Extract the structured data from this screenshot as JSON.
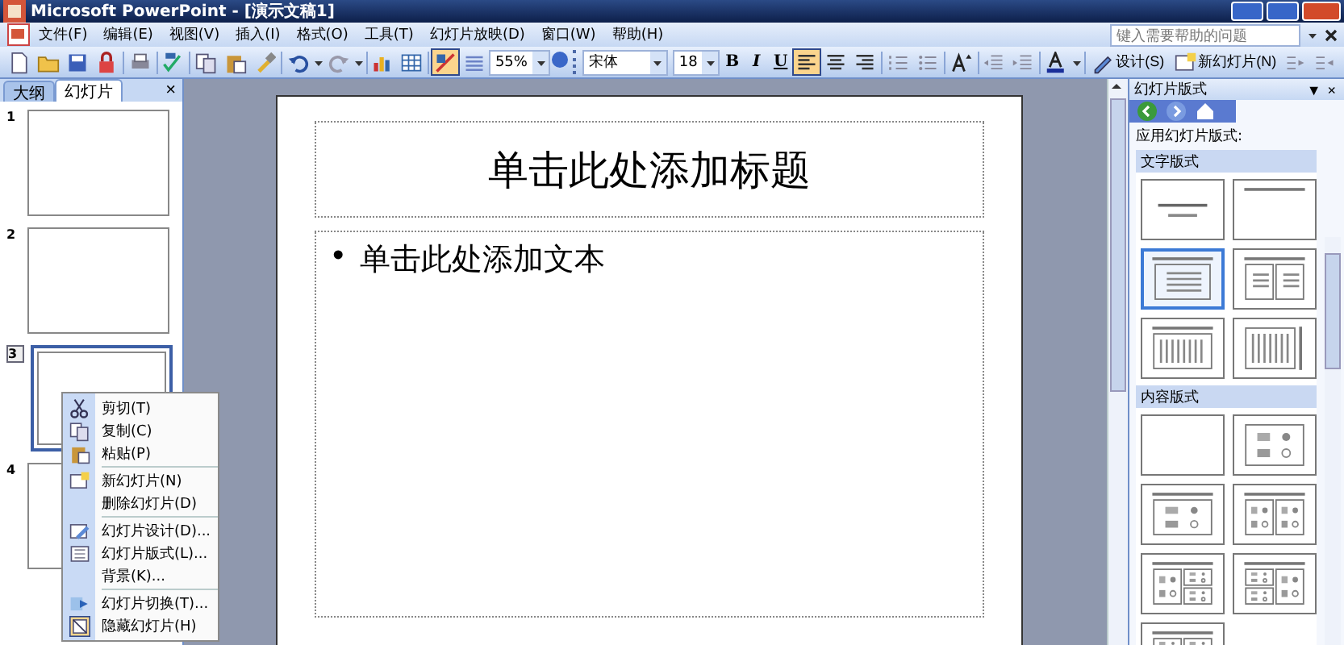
{
  "window": {
    "title": "Microsoft PowerPoint - [演示文稿1]"
  },
  "menu": [
    "文件(F)",
    "编辑(E)",
    "视图(V)",
    "插入(I)",
    "格式(O)",
    "工具(T)",
    "幻灯片放映(D)",
    "窗口(W)",
    "帮助(H)"
  ],
  "help_box": {
    "placeholder": "键入需要帮助的问题"
  },
  "toolbar": {
    "zoom": "55%",
    "font": "宋体",
    "font_size": "18",
    "bold": "B",
    "italic": "I",
    "underline": "U",
    "show_formatting": {
      "selected": true
    },
    "alignment": [
      {
        "selected": true
      },
      {
        "selected": false
      },
      {
        "selected": false
      }
    ],
    "design_button": "设计(S)",
    "new_slide_button": "新幻灯片(N)"
  },
  "left_pane": {
    "tabs": [
      {
        "label": "大纲",
        "selected": false
      },
      {
        "label": "幻灯片",
        "selected": true
      }
    ],
    "close": "×",
    "slides": [
      {
        "number": "1",
        "selected": false
      },
      {
        "number": "2",
        "selected": false
      },
      {
        "number": "3",
        "selected": true
      },
      {
        "number": "4",
        "selected": false
      }
    ]
  },
  "slide": {
    "title_placeholder": "单击此处添加标题",
    "bullet": "•",
    "body_placeholder": "单击此处添加文本"
  },
  "context_menu": [
    [
      {
        "label": "剪切(T)"
      },
      {
        "label": "复制(C)"
      },
      {
        "label": "粘贴(P)"
      }
    ],
    [
      {
        "label": "新幻灯片(N)"
      },
      {
        "label": "删除幻灯片(D)"
      }
    ],
    [
      {
        "label": "幻灯片设计(D)..."
      },
      {
        "label": "幻灯片版式(L)..."
      },
      {
        "label": "背景(K)..."
      }
    ],
    [
      {
        "label": "幻灯片切换(T)..."
      },
      {
        "label": "隐藏幻灯片(H)"
      }
    ]
  ],
  "task_pane": {
    "title": "幻灯片版式",
    "dropdown": "▼",
    "close": "×",
    "apply_label": "应用幻灯片版式:",
    "sections": [
      {
        "title": "文字版式",
        "layouts": [
          {
            "kind": "title-slide",
            "selected": false
          },
          {
            "kind": "title-only",
            "selected": false
          },
          {
            "kind": "title-text",
            "selected": true
          },
          {
            "kind": "title-two-text",
            "selected": false
          },
          {
            "kind": "title-vertical-text",
            "selected": false
          },
          {
            "kind": "vertical-title-text",
            "selected": false
          }
        ]
      },
      {
        "title": "内容版式",
        "layouts": [
          {
            "kind": "blank",
            "selected": false
          },
          {
            "kind": "content",
            "selected": false
          },
          {
            "kind": "title-content",
            "selected": false
          },
          {
            "kind": "title-two-content",
            "selected": false
          },
          {
            "kind": "title-content-two",
            "selected": false
          },
          {
            "kind": "title-two-content-right",
            "selected": false
          },
          {
            "kind": "title-four-content",
            "selected": false
          }
        ]
      }
    ]
  }
}
